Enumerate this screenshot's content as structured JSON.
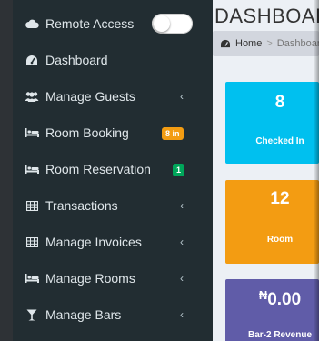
{
  "sidebar": {
    "remote_access": {
      "label": "Remote Access",
      "enabled": false
    },
    "items": [
      {
        "label": "Dashboard",
        "icon": "dashboard-icon"
      },
      {
        "label": "Manage Guests",
        "icon": "users-icon",
        "expandable": true
      },
      {
        "label": "Room Booking",
        "icon": "bed-icon",
        "badge": "8 in",
        "badge_color": "#f39c12"
      },
      {
        "label": "Room Reservation",
        "icon": "bed-icon",
        "badge": "1",
        "badge_color": "#00a65a"
      },
      {
        "label": "Transactions",
        "icon": "table-icon",
        "expandable": true
      },
      {
        "label": "Manage Invoices",
        "icon": "table-icon",
        "expandable": true
      },
      {
        "label": "Manage Rooms",
        "icon": "bed-icon",
        "expandable": true
      },
      {
        "label": "Manage Bars",
        "icon": "cocktail-icon",
        "expandable": true
      }
    ],
    "chevron": "‹"
  },
  "header": {
    "title": "DASHBOARD",
    "breadcrumb": {
      "home": "Home",
      "separator": ">",
      "current": "Dashboard"
    }
  },
  "tiles": [
    {
      "value": "8",
      "label": "Checked In",
      "color": "#00c0ef"
    },
    {
      "value": "12",
      "label": "Room",
      "color": "#f39c12"
    },
    {
      "currency": "₦",
      "value": "0.00",
      "label": "Bar-2 Revenue",
      "color": "#605ca8"
    }
  ]
}
